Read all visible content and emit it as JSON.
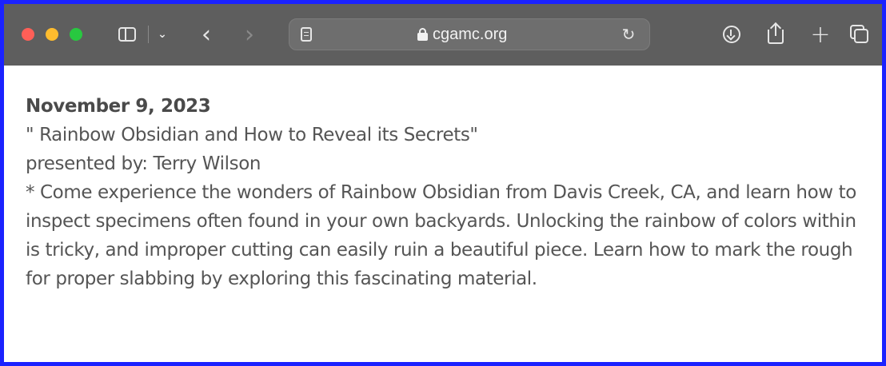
{
  "browser": {
    "url": "cgamc.org",
    "colors": {
      "frame_border": "#1a22ff",
      "toolbar_bg": "#5e5e5e",
      "close": "#ff5f57",
      "minimize": "#febc2e",
      "zoom": "#28c840"
    },
    "icons": {
      "back": "‹",
      "forward": "›",
      "chevron": "⌄",
      "reload": "↻",
      "new_tab": "+"
    }
  },
  "event": {
    "date": "November 9, 2023",
    "title": " \" Rainbow Obsidian and How to Reveal its Secrets\"",
    "presenter": "presented by: Terry Wilson",
    "description": "*  Come experience the wonders of Rainbow Obsidian from Davis Creek, CA, and learn how to inspect specimens often found in your own backyards. Unlocking the rainbow of colors within is tricky, and improper cutting can easily ruin a beautiful piece. Learn how to mark the rough for proper slabbing by exploring this fascinating material."
  }
}
